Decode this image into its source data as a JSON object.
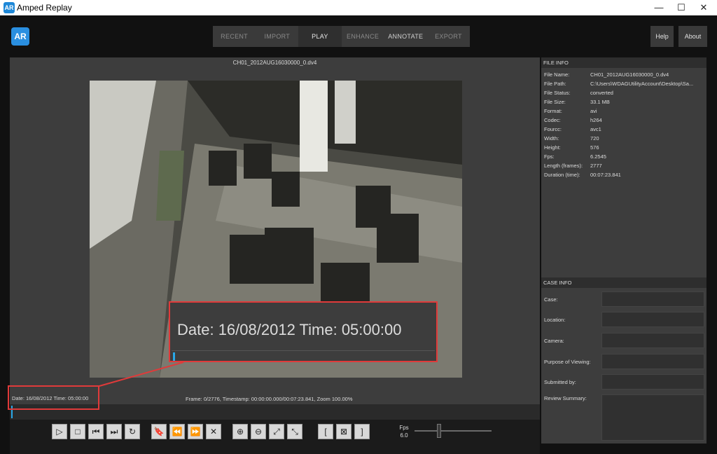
{
  "window": {
    "title": "Amped Replay",
    "logo_text": "AR",
    "minimize": "—",
    "maximize": "☐",
    "close": "✕"
  },
  "app": {
    "logo_text": "AR"
  },
  "nav": {
    "tabs": [
      "RECENT",
      "IMPORT",
      "PLAY",
      "ENHANCE",
      "ANNOTATE",
      "EXPORT"
    ],
    "active": "PLAY"
  },
  "top_buttons": {
    "help": "Help",
    "about": "About"
  },
  "viewer": {
    "filename": "CH01_2012AUG16030000_0.dv4",
    "date_time": "Date: 16/08/2012 Time: 05:00:00",
    "frame_info": "Frame: 0/2776, Timestamp: 00:00:00.000/00:07:23.841,  Zoom 100.00%"
  },
  "callout": {
    "text": "Date: 16/08/2012 Time: 05:00:00"
  },
  "controls": {
    "buttons": [
      {
        "name": "play-button",
        "glyph": "▷"
      },
      {
        "name": "stop-button",
        "glyph": "□"
      },
      {
        "name": "prev-frame-button",
        "glyph": "⏮"
      },
      {
        "name": "next-frame-button",
        "glyph": "⏭"
      },
      {
        "name": "loop-button",
        "glyph": "↻"
      },
      {
        "name": "bookmark-button",
        "glyph": "🔖"
      },
      {
        "name": "rewind-button",
        "glyph": "⏪"
      },
      {
        "name": "fast-forward-button",
        "glyph": "⏩"
      },
      {
        "name": "clear-button",
        "glyph": "✕"
      },
      {
        "name": "zoom-in-button",
        "glyph": "⊕"
      },
      {
        "name": "zoom-out-button",
        "glyph": "⊖"
      },
      {
        "name": "fit-button",
        "glyph": "⤢"
      },
      {
        "name": "actual-size-button",
        "glyph": "⤡"
      },
      {
        "name": "mark-in-button",
        "glyph": "["
      },
      {
        "name": "mark-range-button",
        "glyph": "⊠"
      },
      {
        "name": "mark-out-button",
        "glyph": "]"
      }
    ],
    "fps_label": "Fps",
    "fps_value": "6.0"
  },
  "file_info": {
    "header": "FILE INFO",
    "rows": [
      {
        "k": "File Name:",
        "v": "CH01_2012AUG16030000_0.dv4"
      },
      {
        "k": "File Path:",
        "v": "C:\\Users\\WDAGUtilityAccount\\Desktop\\Sa..."
      },
      {
        "k": "File Status:",
        "v": "converted"
      },
      {
        "k": "File Size:",
        "v": "33.1 MB"
      },
      {
        "k": "Format:",
        "v": "avi"
      },
      {
        "k": "Codec:",
        "v": "h264"
      },
      {
        "k": "Fourcc:",
        "v": "avc1"
      },
      {
        "k": "Width:",
        "v": "720"
      },
      {
        "k": "Height:",
        "v": "576"
      },
      {
        "k": "Fps:",
        "v": "6.2545"
      },
      {
        "k": "Length (frames):",
        "v": "2777"
      },
      {
        "k": "Duration (time):",
        "v": "00:07:23.841"
      }
    ]
  },
  "case_info": {
    "header": "CASE INFO",
    "fields": [
      "Case:",
      "Location:",
      "Camera:",
      "Purpose of Viewing:",
      "Submitted by:",
      "Review Summary:"
    ]
  },
  "colors": {
    "accent": "#2aa8e8",
    "highlight": "#e03a3a"
  }
}
